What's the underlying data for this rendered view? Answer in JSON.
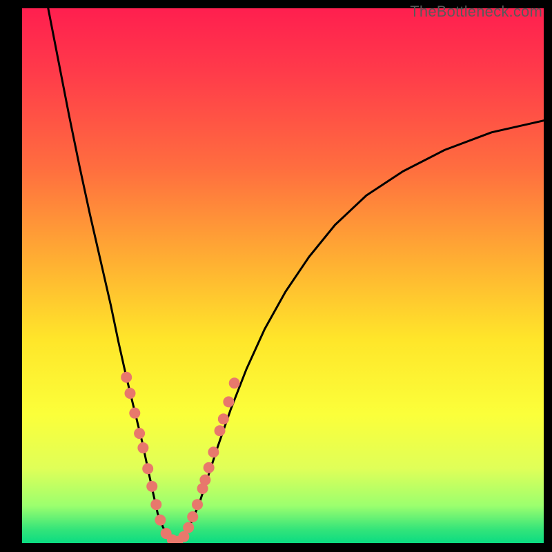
{
  "watermark": "TheBottleneck.com",
  "chart_data": {
    "type": "line",
    "title": "",
    "xlabel": "",
    "ylabel": "",
    "xlim": [
      0,
      100
    ],
    "ylim": [
      0,
      100
    ],
    "gradient_stops": [
      {
        "offset": 0.0,
        "color": "#ff1f4f"
      },
      {
        "offset": 0.12,
        "color": "#ff3b4a"
      },
      {
        "offset": 0.3,
        "color": "#ff6e3f"
      },
      {
        "offset": 0.48,
        "color": "#ffb232"
      },
      {
        "offset": 0.62,
        "color": "#ffe62a"
      },
      {
        "offset": 0.76,
        "color": "#fbff3a"
      },
      {
        "offset": 0.86,
        "color": "#e0ff58"
      },
      {
        "offset": 0.93,
        "color": "#9cff6e"
      },
      {
        "offset": 0.975,
        "color": "#33e47a"
      },
      {
        "offset": 1.0,
        "color": "#0bdc82"
      }
    ],
    "series": [
      {
        "name": "left-arm",
        "x": [
          5.0,
          7.0,
          9.0,
          11.0,
          13.0,
          15.0,
          17.0,
          18.5,
          20.0,
          21.5,
          23.0,
          24.2,
          25.2,
          26.0,
          27.0,
          28.0,
          29.5
        ],
        "y": [
          100.0,
          90.0,
          80.0,
          70.5,
          61.5,
          53.0,
          44.5,
          37.5,
          31.0,
          25.0,
          19.0,
          13.5,
          9.0,
          5.5,
          3.0,
          1.2,
          0.2
        ]
      },
      {
        "name": "right-arm",
        "x": [
          29.5,
          31.0,
          32.5,
          34.0,
          35.5,
          37.5,
          40.0,
          43.0,
          46.5,
          50.5,
          55.0,
          60.0,
          66.0,
          73.0,
          81.0,
          90.0,
          100.0
        ],
        "y": [
          0.2,
          1.5,
          4.0,
          7.5,
          12.0,
          18.0,
          25.0,
          32.5,
          40.0,
          47.0,
          53.5,
          59.5,
          65.0,
          69.5,
          73.5,
          76.8,
          79.0
        ]
      }
    ],
    "scatter": {
      "name": "markers",
      "color": "#e8786c",
      "points": [
        {
          "x": 20.0,
          "y": 31.0
        },
        {
          "x": 20.7,
          "y": 28.0
        },
        {
          "x": 21.6,
          "y": 24.3
        },
        {
          "x": 22.5,
          "y": 20.5
        },
        {
          "x": 23.2,
          "y": 17.8
        },
        {
          "x": 24.1,
          "y": 13.9
        },
        {
          "x": 24.9,
          "y": 10.6
        },
        {
          "x": 25.7,
          "y": 7.2
        },
        {
          "x": 26.5,
          "y": 4.3
        },
        {
          "x": 27.6,
          "y": 1.8
        },
        {
          "x": 28.8,
          "y": 0.6
        },
        {
          "x": 29.8,
          "y": 0.3
        },
        {
          "x": 31.0,
          "y": 1.2
        },
        {
          "x": 31.9,
          "y": 2.9
        },
        {
          "x": 32.7,
          "y": 4.9
        },
        {
          "x": 33.6,
          "y": 7.2
        },
        {
          "x": 34.6,
          "y": 10.2
        },
        {
          "x": 35.1,
          "y": 11.8
        },
        {
          "x": 35.8,
          "y": 14.1
        },
        {
          "x": 36.7,
          "y": 17.0
        },
        {
          "x": 37.9,
          "y": 21.0
        },
        {
          "x": 38.6,
          "y": 23.2
        },
        {
          "x": 39.6,
          "y": 26.4
        },
        {
          "x": 40.7,
          "y": 29.9
        }
      ]
    }
  }
}
